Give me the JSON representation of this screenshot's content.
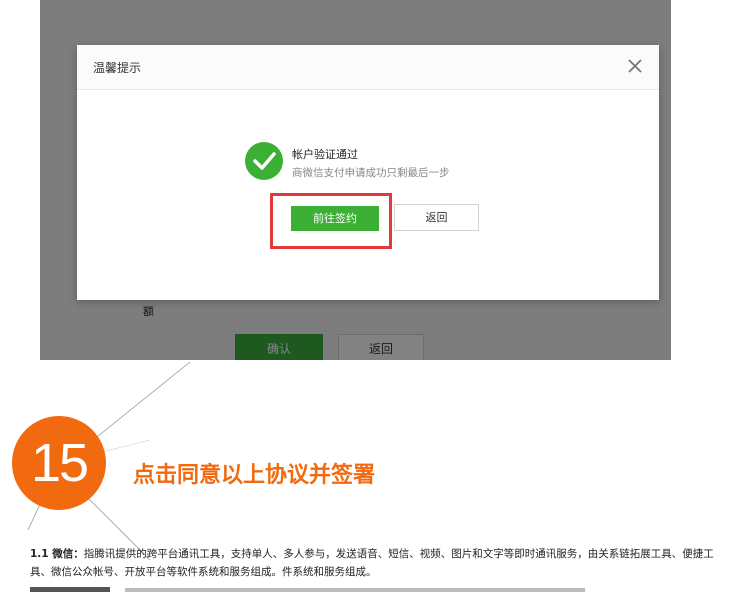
{
  "background_page": {
    "amount_label": "额",
    "confirm_label": "确认",
    "back_label": "返回"
  },
  "modal": {
    "title": "温馨提示",
    "close_icon": "close-icon",
    "success_icon": "check-circle-icon",
    "message_title": "帐户验证通过",
    "message_subtitle": "商微信支付申请成功只剩最后一步",
    "primary_button": "前往签约",
    "secondary_button": "返回",
    "highlight_color": "#e23a3a",
    "accent_color": "#3cb035"
  },
  "step": {
    "number": "15",
    "title": "点击同意以上协议并签署",
    "color": "#f26a10"
  },
  "agreement": {
    "item_label": "1.1 微信：",
    "item_text": "指腾讯提供的跨平台通讯工具，支持单人、多人参与，发送语音、短信、视频、图片和文字等即时通讯服务，由关系链拓展工具、便捷工具、微信公众帐号、开放平台等软件系统和服务组成。件系统和服务组成。"
  }
}
